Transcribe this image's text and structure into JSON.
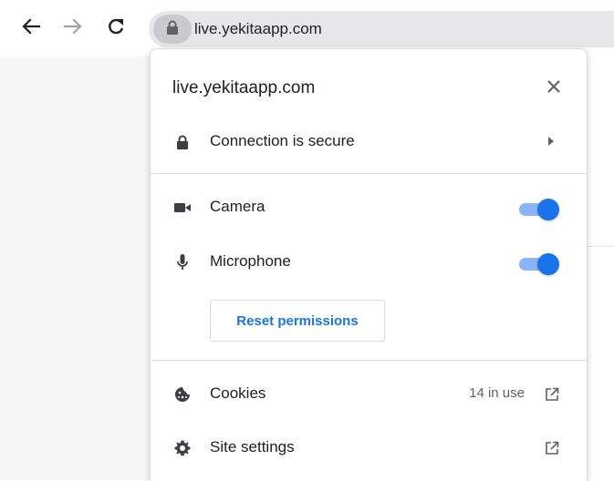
{
  "toolbar": {
    "url": "live.yekitaapp.com",
    "back_icon": "back-arrow-icon",
    "forward_icon": "forward-arrow-icon",
    "reload_icon": "reload-icon",
    "lock_icon": "lock-icon"
  },
  "popup": {
    "title": "live.yekitaapp.com",
    "close_icon": "close-icon",
    "connection": {
      "label": "Connection is secure",
      "icon": "lock-icon",
      "arrow_icon": "caret-right-icon"
    },
    "permissions": [
      {
        "label": "Camera",
        "icon": "camera-icon",
        "enabled": true
      },
      {
        "label": "Microphone",
        "icon": "microphone-icon",
        "enabled": true
      }
    ],
    "reset_label": "Reset permissions",
    "cookies": {
      "label": "Cookies",
      "value": "14 in use",
      "icon": "cookie-icon",
      "link_icon": "external-link-icon"
    },
    "site_settings": {
      "label": "Site settings",
      "icon": "gear-icon",
      "link_icon": "external-link-icon"
    }
  },
  "colors": {
    "accent": "#1a73e8",
    "toggle_track": "#8ab4f8",
    "text": "#202124",
    "secondary_text": "#5f6368",
    "omnibox_bg": "#e5e7ea"
  }
}
